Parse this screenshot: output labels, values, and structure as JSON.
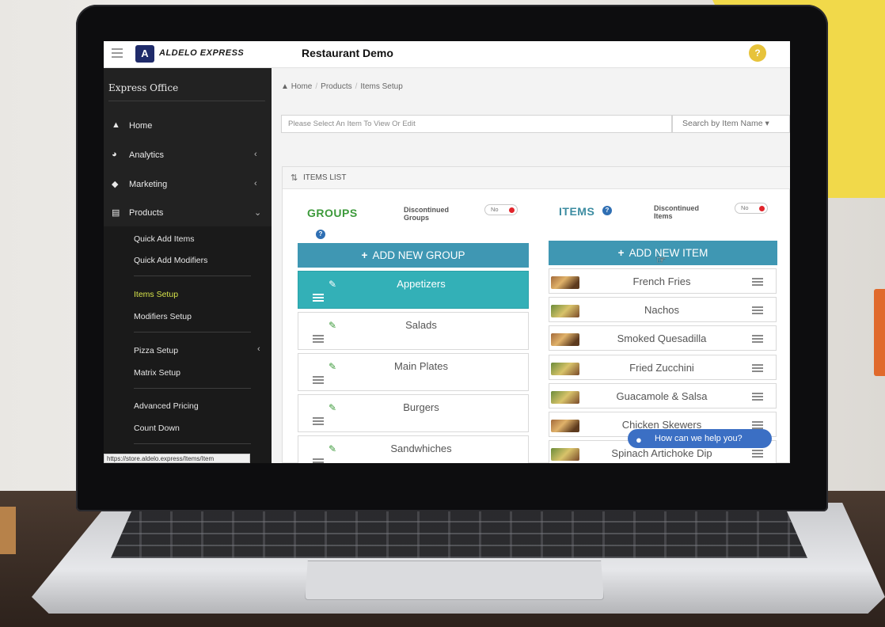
{
  "header": {
    "logo_text": "ALDELO EXPRESS",
    "app_title": "Restaurant Demo",
    "help_icon": "?"
  },
  "sidebar": {
    "heading": "Express Office",
    "items": [
      {
        "label": "Home",
        "icon": "home-icon"
      },
      {
        "label": "Analytics",
        "icon": "pie-chart-icon"
      },
      {
        "label": "Marketing",
        "icon": "tag-icon"
      },
      {
        "label": "Products",
        "icon": "list-icon"
      }
    ],
    "products_subitems": [
      "Quick Add Items",
      "Quick Add Modifiers",
      "Items Setup",
      "Modifiers Setup",
      "Pizza Setup",
      "Matrix Setup",
      "Advanced Pricing",
      "Count Down"
    ],
    "active_subitem": "Items Setup",
    "status_url": "https://store.aldelo.express/Items/Item"
  },
  "breadcrumb": [
    "Home",
    "Products",
    "Items Setup"
  ],
  "item_select": {
    "placeholder": "Please Select An Item To View Or Edit",
    "search_mode": "Search by Item Name"
  },
  "panel": {
    "title": "ITEMS LIST",
    "groups": {
      "title": "GROUPS",
      "discontinued_label": "Discontinued Groups",
      "toggle": "No",
      "add_button": "ADD NEW GROUP",
      "list": [
        "Appetizers",
        "Salads",
        "Main Plates",
        "Burgers",
        "Sandwhiches"
      ],
      "active": "Appetizers"
    },
    "items": {
      "title": "ITEMS",
      "discontinued_label": "Discontinued Items",
      "toggle": "No",
      "add_button": "ADD NEW ITEM",
      "list": [
        "French Fries",
        "Nachos",
        "Smoked Quesadilla",
        "Fried Zucchini",
        "Guacamole & Salsa",
        "Chicken Skewers",
        "Spinach Artichoke Dip"
      ]
    }
  },
  "chat": {
    "label": "How can we help you?"
  },
  "colors": {
    "sidebar_bg": "#222222",
    "active_nav": "#d6e34a",
    "group_title": "#3d9a3b",
    "items_title": "#3c8ca1",
    "button": "#3f97b3",
    "active_group": "#33b0b7",
    "toggle_dot": "#e1242b"
  }
}
